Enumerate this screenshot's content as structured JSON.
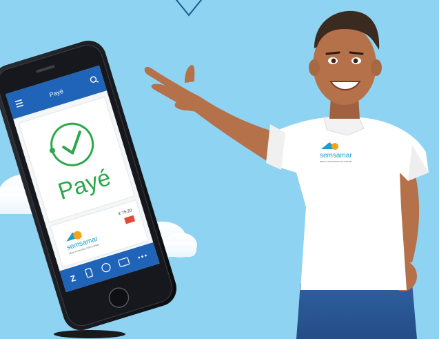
{
  "phone": {
    "header_title": "Payé",
    "status_text": "Payé",
    "amount": "€ 75,20",
    "brand_logo_text": "semsamar",
    "brand_tagline": "NEGO·CONSTRUCTION·CARAIB",
    "search_icon": "search-icon",
    "menu_icon": "menu-icon",
    "check_icon": "check-circle-icon"
  },
  "shirt": {
    "brand_logo_text": "semsamar",
    "brand_tagline": "NEGO·CONSTRUCTION·CARAIB"
  },
  "colors": {
    "background": "#8fd3f2",
    "app_blue": "#1f64b8",
    "success_green": "#2aa84a",
    "brand_teal": "#1b9fc9",
    "brand_orange": "#f4a41c"
  }
}
